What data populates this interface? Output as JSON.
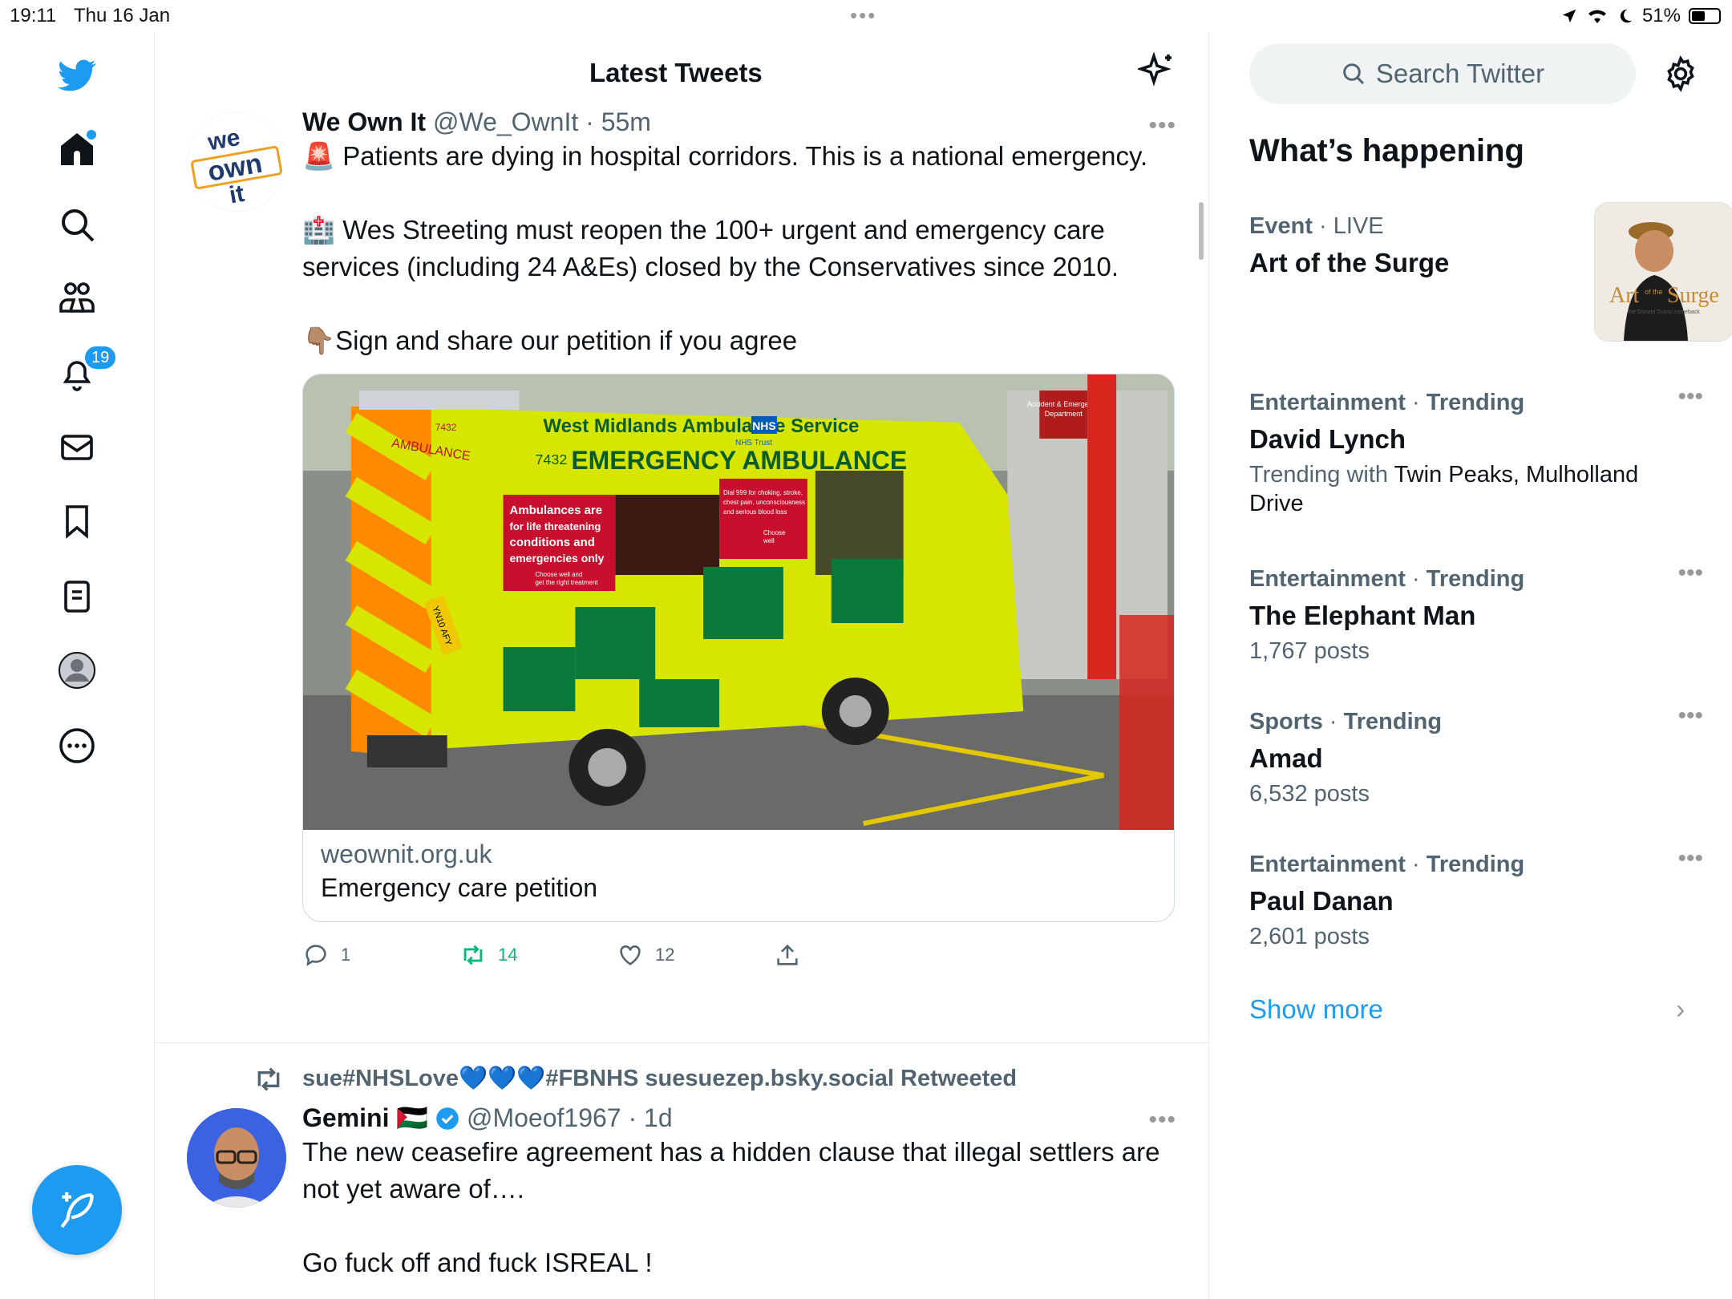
{
  "status": {
    "time": "19:11",
    "date": "Thu 16 Jan",
    "battery": "51%",
    "battery_level": 0.51
  },
  "nav": {
    "notifications_badge": "19"
  },
  "timeline": {
    "title": "Latest Tweets",
    "tweets": [
      {
        "name": "We Own It",
        "handle": "@We_OwnIt",
        "time": "55m",
        "avatar_text": [
          "we",
          "own",
          "it"
        ],
        "paragraphs": [
          "🚨 Patients are dying in hospital corridors. This is a national emergency.",
          "🏥 Wes Streeting must reopen the 100+ urgent and emergency care services (including 24 A&Es) closed by the Conservatives since 2010.",
          "👇🏽Sign and share our petition if you agree"
        ],
        "card": {
          "domain": "weownit.org.uk",
          "title": "Emergency care petition"
        },
        "image": {
          "ambulance_service": "West  Midlands Ambulance Service",
          "nhs": "NHS",
          "nhs_trust": "NHS Trust",
          "vehicle_number": "7432",
          "vehicle_type": "EMERGENCY AMBULANCE",
          "rear_label": "AMBULANCE",
          "rear_number": "7432",
          "panel_left": [
            "Ambulances are",
            "for life threatening",
            "conditions and",
            "emergencies only"
          ],
          "panel_left_small": [
            "Choose well and",
            "get the right treatment"
          ],
          "panel_right": [
            "Dial 999 for choking, stroke,",
            "chest pain, unconsciousness",
            "and serious blood loss"
          ],
          "panel_right_small": [
            "Choose",
            "well"
          ],
          "plate": "YN10 AFY",
          "building_sign": [
            "Accident & Emergency",
            "Department"
          ]
        },
        "replies": "1",
        "retweets": "14",
        "likes": "12"
      },
      {
        "retweeted_by": "sue#NHSLove💙💙💙#FBNHS suesuezep.bsky.social Retweeted",
        "name": "Gemini 🇵🇸",
        "handle": "@Moeof1967",
        "time": "1d",
        "paragraphs": [
          "The new ceasefire agreement has  a hidden clause that illegal settlers are not yet aware of….",
          "Go fuck off and fuck ISREAL !"
        ]
      }
    ]
  },
  "sidebar": {
    "search_placeholder": "Search Twitter",
    "title": "What’s happening",
    "event": {
      "category": "Event",
      "label": "LIVE",
      "topic": "Art of the Surge",
      "thumb_art": "Art",
      "thumb_of_the": "of the",
      "thumb_surge": "Surge",
      "thumb_caption": "the Donald Trump comeback"
    },
    "trends": [
      {
        "category": "Entertainment",
        "label": "Trending",
        "topic": "David Lynch",
        "sub_prefix": "Trending with",
        "sub_highlight": "Twin Peaks, Mulholland Drive"
      },
      {
        "category": "Entertainment",
        "label": "Trending",
        "topic": "The Elephant Man",
        "sub": "1,767 posts"
      },
      {
        "category": "Sports",
        "label": "Trending",
        "topic": "Amad",
        "sub": "6,532 posts"
      },
      {
        "category": "Entertainment",
        "label": "Trending",
        "topic": "Paul Danan",
        "sub": "2,601 posts"
      }
    ],
    "show_more": "Show more"
  },
  "colors": {
    "accent": "#1d9bf0",
    "retweet_green": "#00ba7c"
  }
}
